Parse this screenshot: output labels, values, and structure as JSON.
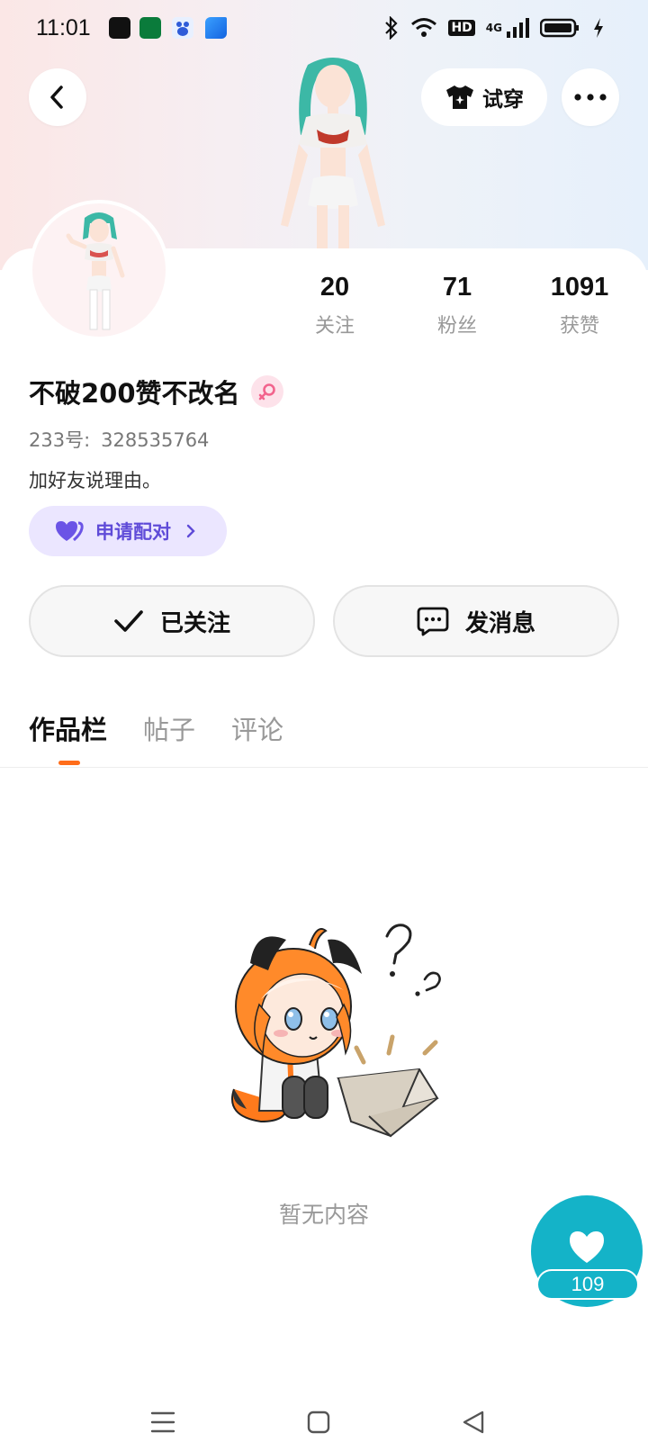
{
  "status_bar": {
    "time": "11:01",
    "network": "4G",
    "hd": "HD",
    "app_icons": [
      "tiktok-icon",
      "cooo-icon",
      "baidu-icon",
      "blue-app-icon"
    ]
  },
  "header": {
    "try_on_label": "试穿"
  },
  "profile": {
    "username": "不破200赞不改名",
    "uid_label": "233号:",
    "uid_value": "328535764",
    "bio": "加好友说理由。",
    "pair_label": "申请配对",
    "gender": "female"
  },
  "stats": [
    {
      "value": "20",
      "label": "关注"
    },
    {
      "value": "71",
      "label": "粉丝"
    },
    {
      "value": "1091",
      "label": "获赞"
    }
  ],
  "actions": {
    "follow_label": "已关注",
    "message_label": "发消息"
  },
  "tabs": [
    {
      "label": "作品栏",
      "active": true
    },
    {
      "label": "帖子",
      "active": false
    },
    {
      "label": "评论",
      "active": false
    }
  ],
  "empty_state": {
    "text": "暂无内容"
  },
  "like": {
    "count": "109"
  },
  "colors": {
    "accent_orange": "#ff6d1a",
    "like_teal": "#14b3c8",
    "pair_purple": "#5f4bd8",
    "pair_bg": "#ebe6ff"
  }
}
